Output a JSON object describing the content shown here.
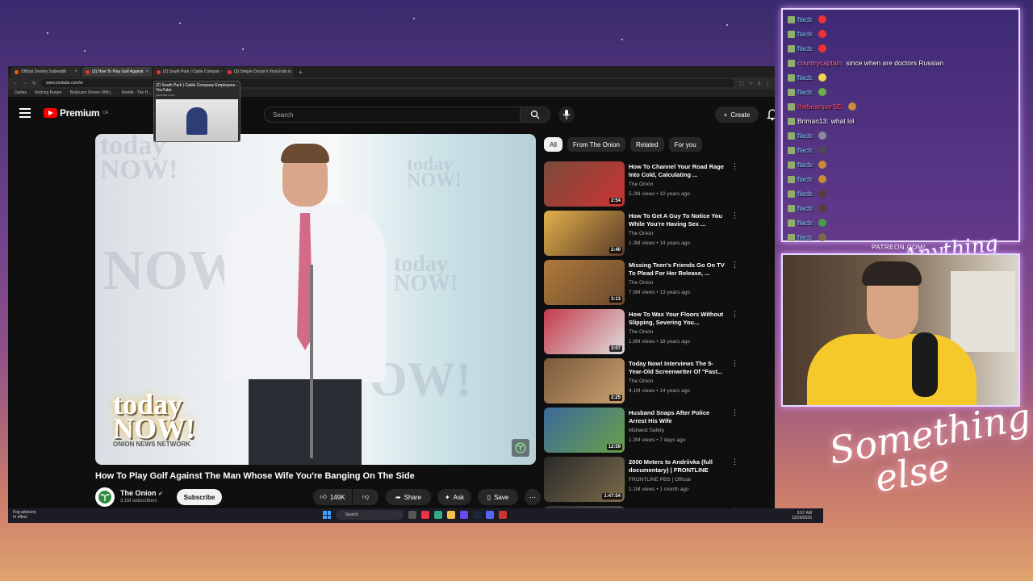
{
  "browser": {
    "tabs": [
      {
        "label": "Official Destiny Subreddit"
      },
      {
        "label": "(3) How To Play Golf Against"
      },
      {
        "label": "(2) South Park | Cable Compan"
      },
      {
        "label": "(3) Simple Doctor's Visit Ends in"
      }
    ],
    "new_tab": "+",
    "url": "www.youtube.com/w",
    "bookmarks": [
      "Dailies",
      "Nothing Burger",
      "Bodycam Shows Offici...",
      "Reddit - The H..."
    ],
    "tab_preview": {
      "title": "(2) South Park | Cable Company Employees - YouTube",
      "domain": "youtube.com"
    }
  },
  "youtube": {
    "brand": "Premium",
    "region": "CA",
    "search_placeholder": "Search",
    "create_label": "Create",
    "video": {
      "logo_line1": "today",
      "logo_line2": "NOW!",
      "logo_sub": "ONION NEWS NETWORK",
      "bg_words": [
        "today NOW!",
        "today NOW!",
        "NOW!",
        "today NOW!",
        "OW!"
      ],
      "title": "How To Play Golf Against The Man Whose Wife You're Banging On The Side",
      "channel": "The Onion",
      "subscribers": "3.1M subscribers",
      "subscribe_label": "Subscribe",
      "likes": "149K",
      "share_label": "Share",
      "ask_label": "Ask",
      "save_label": "Save"
    },
    "chips": [
      "All",
      "From The Onion",
      "Related",
      "For you"
    ],
    "recommendations": [
      {
        "title": "How To Channel Your Road Rage Into Cold, Calculating ...",
        "channel": "The Onion",
        "meta": "5.2M views • 10 years ago",
        "duration": "2:54",
        "c1": "#7a4b3a",
        "c2": "#c33"
      },
      {
        "title": "How To Get A Guy To Notice You While You're Having Sex ...",
        "channel": "The Onion",
        "meta": "1.3M views • 14 years ago",
        "duration": "2:40",
        "c1": "#e2b04a",
        "c2": "#5a3b2a"
      },
      {
        "title": "Missing Teen's Friends Go On TV To Plead For Her Release, ...",
        "channel": "The Onion",
        "meta": "7.9M views • 13 years ago",
        "duration": "3:13",
        "c1": "#b07a3a",
        "c2": "#6a4a30"
      },
      {
        "title": "How To Wax Your Floors Without Slipping, Severing You...",
        "channel": "The Onion",
        "meta": "1.8M views • 16 years ago",
        "duration": "3:07",
        "c1": "#c43a4a",
        "c2": "#ddd"
      },
      {
        "title": "Today Now! Interviews The 5-Year-Old Screenwriter Of \"Fast...",
        "channel": "The Onion",
        "meta": "4.1M views • 14 years ago",
        "duration": "2:25",
        "c1": "#7a5a3a",
        "c2": "#c9a070"
      },
      {
        "title": "Husband Snaps After Police Arrest His Wife",
        "channel": "Midwest Safety",
        "meta": "1.3M views • 7 days ago",
        "duration": "12:59",
        "c1": "#3a6a9a",
        "c2": "#6aa04a"
      },
      {
        "title": "2000 Meters to Andriivka (full documentary) | FRONTLINE",
        "channel": "FRONTLINE PBS | Official",
        "meta": "1.1M views • 1 month ago",
        "duration": "1:47:54",
        "c1": "#2a2a2a",
        "c2": "#7a6a4a"
      },
      {
        "title": "Reporter: Play Up Plane...",
        "channel": "",
        "meta": "",
        "duration": "",
        "c1": "#333",
        "c2": "#555"
      }
    ]
  },
  "taskbar": {
    "weather_line1": "Fog advisory",
    "weather_line2": "In effect",
    "search_label": "Search",
    "time": "3:57 AM",
    "date": "12/29/2025"
  },
  "chat": {
    "messages": [
      {
        "user": "flacb:",
        "text": "",
        "color": "#7bd6ff",
        "emote": "#e33"
      },
      {
        "user": "flacb:",
        "text": "",
        "color": "#7bd6ff",
        "emote": "#e33"
      },
      {
        "user": "flacb:",
        "text": "",
        "color": "#7bd6ff",
        "emote": "#e33"
      },
      {
        "user": "countrycaptain:",
        "text": "since when are doctors Russian",
        "color": "#ff6e9e",
        "emote": ""
      },
      {
        "user": "flacb:",
        "text": "",
        "color": "#7bd6ff",
        "emote": "#f2d64a"
      },
      {
        "user": "flacb:",
        "text": "",
        "color": "#7bd6ff",
        "emote": "#6ab04a"
      },
      {
        "user": "thebeartperSE:",
        "text": "",
        "color": "#ff4a6a",
        "emote": "#c98a3a"
      },
      {
        "user": "Briman13:",
        "text": "what lol",
        "color": "#ffffff",
        "emote": ""
      },
      {
        "user": "flacb:",
        "text": "",
        "color": "#7bd6ff",
        "emote": "#8a8a9a"
      },
      {
        "user": "flacb:",
        "text": "",
        "color": "#7bd6ff",
        "emote": "#4a4a5a"
      },
      {
        "user": "flacb:",
        "text": "",
        "color": "#7bd6ff",
        "emote": "#c98a3a"
      },
      {
        "user": "flacb:",
        "text": "",
        "color": "#7bd6ff",
        "emote": "#c98a3a"
      },
      {
        "user": "flacb:",
        "text": "",
        "color": "#7bd6ff",
        "emote": "#5a3a3a"
      },
      {
        "user": "flacb:",
        "text": "",
        "color": "#7bd6ff",
        "emote": "#5a3a3a"
      },
      {
        "user": "flacb:",
        "text": "",
        "color": "#7bd6ff",
        "emote": "#4a9a4a"
      },
      {
        "user": "flacb:",
        "text": "",
        "color": "#7bd6ff",
        "emote": "#7a6a4a"
      }
    ]
  },
  "overlay": {
    "patreon": "PATREON.COM/",
    "brand_small": "Anything else",
    "brand_big_line1": "Something",
    "brand_big_line2": "else"
  },
  "colors": {
    "yt_red": "#ff0000",
    "chat_border": "#e7d8ff"
  }
}
